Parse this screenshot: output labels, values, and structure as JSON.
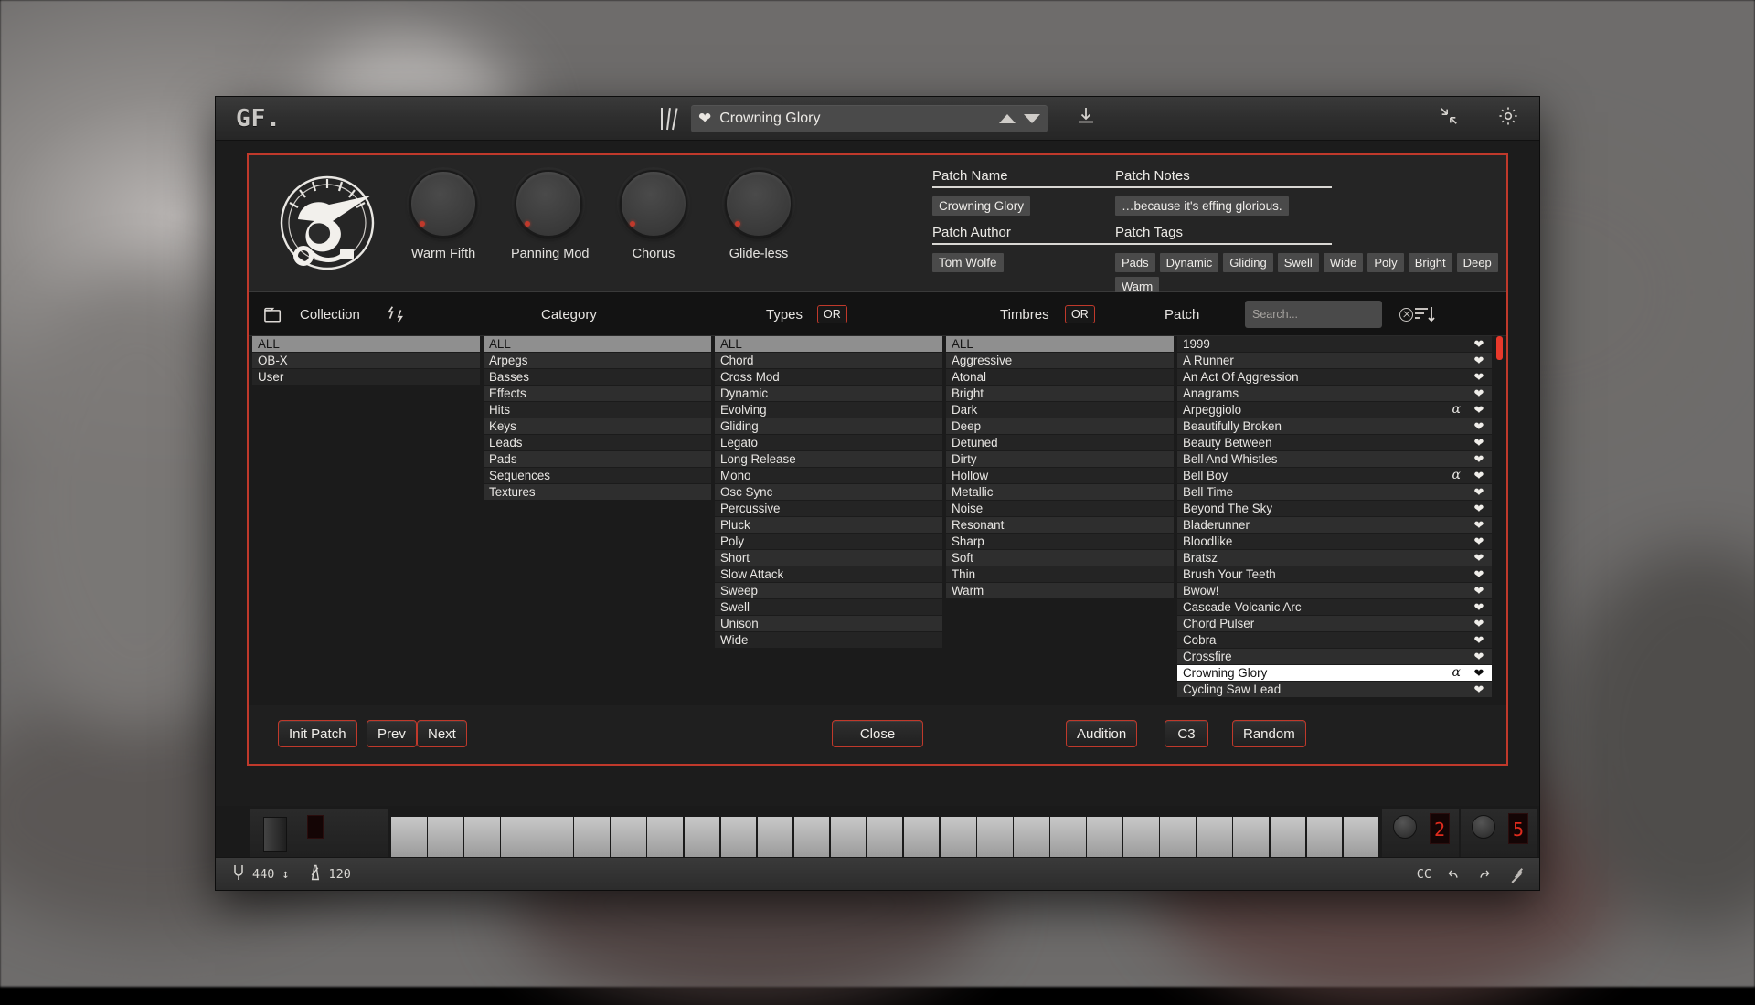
{
  "titlebar": {
    "logo": "GF.",
    "book_icon": "book-icon",
    "favorite_icon": "heart-icon",
    "preset_name": "Crowning Glory",
    "prev_icon": "triangle-up-icon",
    "next_icon": "triangle-down-icon",
    "download_icon": "download-icon",
    "collapse_icon": "collapse-arrows-icon",
    "settings_icon": "gear-icon"
  },
  "info": {
    "logo_mark": "synth-mark-logo",
    "knobs": [
      {
        "label": "Warm Fifth"
      },
      {
        "label": "Panning Mod"
      },
      {
        "label": "Chorus"
      },
      {
        "label": "Glide-less"
      }
    ],
    "patch_name_label": "Patch Name",
    "patch_name_value": "Crowning Glory",
    "patch_author_label": "Patch Author",
    "patch_author_value": "Tom Wolfe",
    "patch_notes_label": "Patch Notes",
    "patch_notes_value": "…because it's effing glorious.",
    "patch_tags_label": "Patch Tags",
    "patch_tags": [
      "Pads",
      "Dynamic",
      "Gliding",
      "Swell",
      "Wide",
      "Poly",
      "Bright",
      "Deep",
      "Warm"
    ]
  },
  "toolbar": {
    "folder_icon": "folder-icon",
    "collection_label": "Collection",
    "refresh_icon": "shuffle-icon",
    "category_label": "Category",
    "types_label": "Types",
    "types_or": "OR",
    "timbres_label": "Timbres",
    "timbres_or": "OR",
    "patch_label": "Patch",
    "search_placeholder": "Search...",
    "search_value": "",
    "clear_icon": "clear-circle-icon",
    "sort_icon": "sort-descending-icon"
  },
  "columns": {
    "collection": [
      "ALL",
      "OB-X",
      "User"
    ],
    "collection_selected": "ALL",
    "category": [
      "ALL",
      "Arpegs",
      "Basses",
      "Effects",
      "Hits",
      "Keys",
      "Leads",
      "Pads",
      "Sequences",
      "Textures"
    ],
    "category_selected": "ALL",
    "types": [
      "ALL",
      "Chord",
      "Cross Mod",
      "Dynamic",
      "Evolving",
      "Gliding",
      "Legato",
      "Long Release",
      "Mono",
      "Osc Sync",
      "Percussive",
      "Pluck",
      "Poly",
      "Short",
      "Slow Attack",
      "Sweep",
      "Swell",
      "Unison",
      "Wide"
    ],
    "types_selected": "ALL",
    "timbres": [
      "ALL",
      "Aggressive",
      "Atonal",
      "Bright",
      "Dark",
      "Deep",
      "Detuned",
      "Dirty",
      "Hollow",
      "Metallic",
      "Noise",
      "Resonant",
      "Sharp",
      "Soft",
      "Thin",
      "Warm"
    ],
    "timbres_selected": "ALL"
  },
  "patches": [
    {
      "name": "1999",
      "alpha": "",
      "favorite": true
    },
    {
      "name": "A Runner",
      "alpha": "",
      "favorite": true
    },
    {
      "name": "An Act Of Aggression",
      "alpha": "",
      "favorite": true
    },
    {
      "name": "Anagrams",
      "alpha": "",
      "favorite": true
    },
    {
      "name": "Arpeggiolo",
      "alpha": "α",
      "favorite": true
    },
    {
      "name": "Beautifully Broken",
      "alpha": "",
      "favorite": true
    },
    {
      "name": "Beauty Between",
      "alpha": "",
      "favorite": true
    },
    {
      "name": "Bell And Whistles",
      "alpha": "",
      "favorite": true
    },
    {
      "name": "Bell Boy",
      "alpha": "α",
      "favorite": true
    },
    {
      "name": "Bell Time",
      "alpha": "",
      "favorite": true
    },
    {
      "name": "Beyond The Sky",
      "alpha": "",
      "favorite": true
    },
    {
      "name": "Bladerunner",
      "alpha": "",
      "favorite": true
    },
    {
      "name": "Bloodlike",
      "alpha": "",
      "favorite": true
    },
    {
      "name": "Bratsz",
      "alpha": "",
      "favorite": true
    },
    {
      "name": "Brush Your Teeth",
      "alpha": "",
      "favorite": true
    },
    {
      "name": "Bwow!",
      "alpha": "",
      "favorite": true
    },
    {
      "name": "Cascade Volcanic Arc",
      "alpha": "",
      "favorite": true
    },
    {
      "name": "Chord Pulser",
      "alpha": "",
      "favorite": true
    },
    {
      "name": "Cobra",
      "alpha": "",
      "favorite": true
    },
    {
      "name": "Crossfire",
      "alpha": "",
      "favorite": true
    },
    {
      "name": "Crowning Glory",
      "alpha": "α",
      "favorite": true
    },
    {
      "name": "Cycling Saw Lead",
      "alpha": "",
      "favorite": true
    }
  ],
  "patch_selected": "Crowning Glory",
  "buttons": {
    "init_patch": "Init Patch",
    "prev": "Prev",
    "next": "Next",
    "close": "Close",
    "audition": "Audition",
    "note": "C3",
    "random": "Random"
  },
  "statusbar": {
    "tuning_icon": "tuning-fork-icon",
    "tuning_value": "440",
    "tuning_arrows": "↕",
    "tempo_icon": "metronome-icon",
    "tempo_value": "120",
    "cc_label": "CC",
    "undo_icon": "undo-icon",
    "redo_icon": "redo-icon",
    "resize_icon": "resize-grip-icon"
  },
  "keyboard": {
    "left_led": "",
    "right_pad_1_value": "2",
    "right_pad_2_value": "5"
  },
  "colors": {
    "accent": "#c0392b",
    "scrollbar": "#e8392b",
    "panel": "#1f1f1f"
  }
}
